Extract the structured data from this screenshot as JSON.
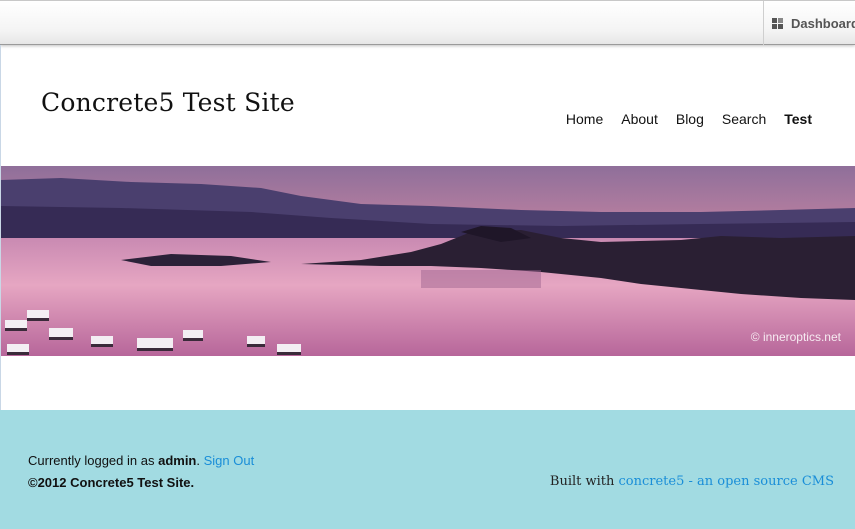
{
  "toolbar": {
    "dashboard_label": "Dashboard"
  },
  "header": {
    "site_title": "Concrete5 Test Site",
    "nav": [
      {
        "label": "Home"
      },
      {
        "label": "About"
      },
      {
        "label": "Blog"
      },
      {
        "label": "Search"
      },
      {
        "label": "Test",
        "active": true
      }
    ]
  },
  "banner": {
    "credit": "© inneroptics.net"
  },
  "footer": {
    "logged_in_prefix": "Currently logged in as",
    "username": "admin",
    "sign_out": "Sign Out",
    "copyright": "©2012 Concrete5 Test Site.",
    "built_with_prefix": "Built with",
    "built_with_link": "concrete5 - an open source CMS"
  },
  "colors": {
    "footer_bg": "#a2dbe2",
    "link": "#1a8ed8"
  }
}
